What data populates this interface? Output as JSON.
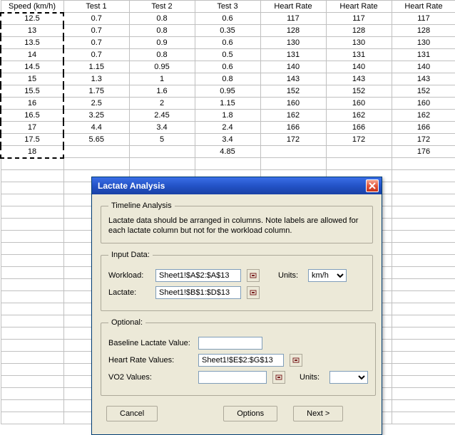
{
  "sheet": {
    "headers": [
      "Speed (km/h)",
      "Test 1",
      "Test 2",
      "Test 3",
      "Heart Rate",
      "Heart Rate",
      "Heart Rate"
    ],
    "rows": [
      [
        "12.5",
        "0.7",
        "0.8",
        "0.6",
        "117",
        "117",
        "117"
      ],
      [
        "13",
        "0.7",
        "0.8",
        "0.35",
        "128",
        "128",
        "128"
      ],
      [
        "13.5",
        "0.7",
        "0.9",
        "0.6",
        "130",
        "130",
        "130"
      ],
      [
        "14",
        "0.7",
        "0.8",
        "0.5",
        "131",
        "131",
        "131"
      ],
      [
        "14.5",
        "1.15",
        "0.95",
        "0.6",
        "140",
        "140",
        "140"
      ],
      [
        "15",
        "1.3",
        "1",
        "0.8",
        "143",
        "143",
        "143"
      ],
      [
        "15.5",
        "1.75",
        "1.6",
        "0.95",
        "152",
        "152",
        "152"
      ],
      [
        "16",
        "2.5",
        "2",
        "1.15",
        "160",
        "160",
        "160"
      ],
      [
        "16.5",
        "3.25",
        "2.45",
        "1.8",
        "162",
        "162",
        "162"
      ],
      [
        "17",
        "4.4",
        "3.4",
        "2.4",
        "166",
        "166",
        "166"
      ],
      [
        "17.5",
        "5.65",
        "5",
        "3.4",
        "172",
        "172",
        "172"
      ],
      [
        "18",
        "",
        "",
        "4.85",
        "",
        "",
        "176"
      ]
    ]
  },
  "dialog": {
    "title": "Lactate Analysis",
    "timeline": {
      "legend": "Timeline Analysis",
      "text": "Lactate data should be arranged in columns. Note labels are allowed for each lactate column but not for the workload column."
    },
    "input": {
      "legend": "Input Data:",
      "workload_label": "Workload:",
      "workload_value": "Sheet1!$A$2:$A$13",
      "units_label": "Units:",
      "units_value": "km/h",
      "lactate_label": "Lactate:",
      "lactate_value": "Sheet1!$B$1:$D$13"
    },
    "optional": {
      "legend": "Optional:",
      "baseline_label": "Baseline Lactate Value:",
      "baseline_value": "",
      "hr_label": "Heart Rate Values:",
      "hr_value": "Sheet1!$E$2:$G$13",
      "vo2_label": "VO2 Values:",
      "vo2_value": "",
      "vo2_units_label": "Units:",
      "vo2_units_value": ""
    },
    "buttons": {
      "cancel": "Cancel",
      "options": "Options",
      "next": "Next >"
    }
  }
}
